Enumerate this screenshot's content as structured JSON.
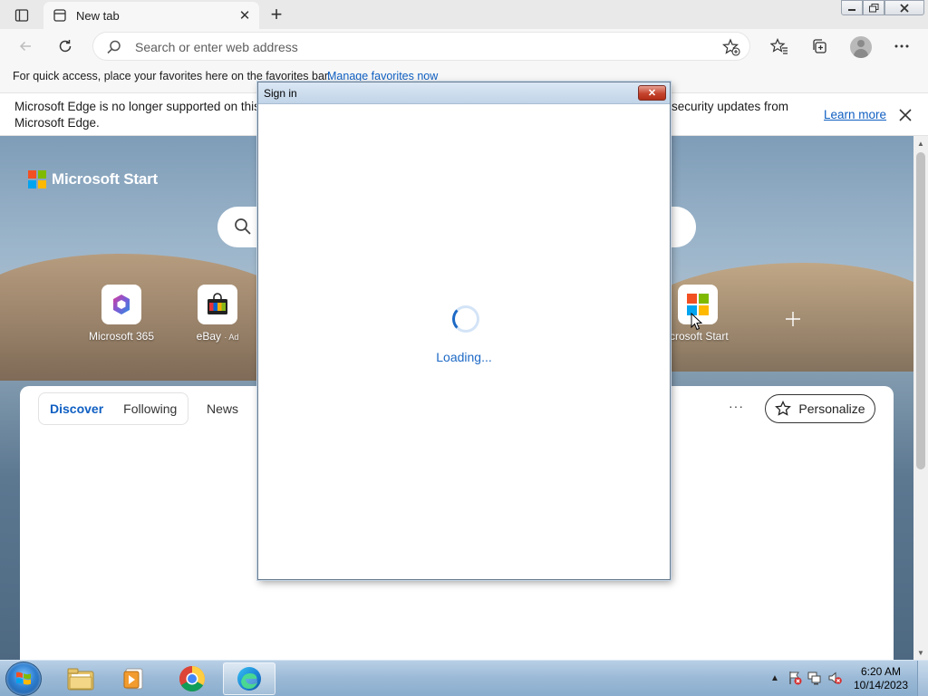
{
  "tab": {
    "title": "New tab",
    "close": "✕"
  },
  "newtab": "+",
  "address": {
    "placeholder": "Search or enter web address"
  },
  "favorites_bar": {
    "message": "For quick access, place your favorites here on the favorites bar.",
    "link": "Manage favorites now"
  },
  "infobar": {
    "line1": "Microsoft Edge is no longer supported on this",
    "line2": "Microsoft Edge.",
    "line3": "security updates from",
    "learn_more": "Learn more"
  },
  "ntp": {
    "brand": "Microsoft Start",
    "quick_links": [
      {
        "name": "Microsoft 365",
        "ad": ""
      },
      {
        "name": "eBay",
        "ad": "· Ad"
      },
      {
        "name": "icrosoft Start",
        "ad": ""
      }
    ],
    "feed_tabs": [
      "Discover",
      "Following"
    ],
    "news_tab": "News",
    "more": "···",
    "personalize": "Personalize"
  },
  "dialog": {
    "title": "Sign in",
    "close": "✕",
    "loading": "Loading..."
  },
  "taskbar": {
    "time": "6:20 AM",
    "date": "10/14/2023"
  },
  "colors": {
    "accent": "#0f5fc2",
    "loading": "#1d69c5"
  }
}
